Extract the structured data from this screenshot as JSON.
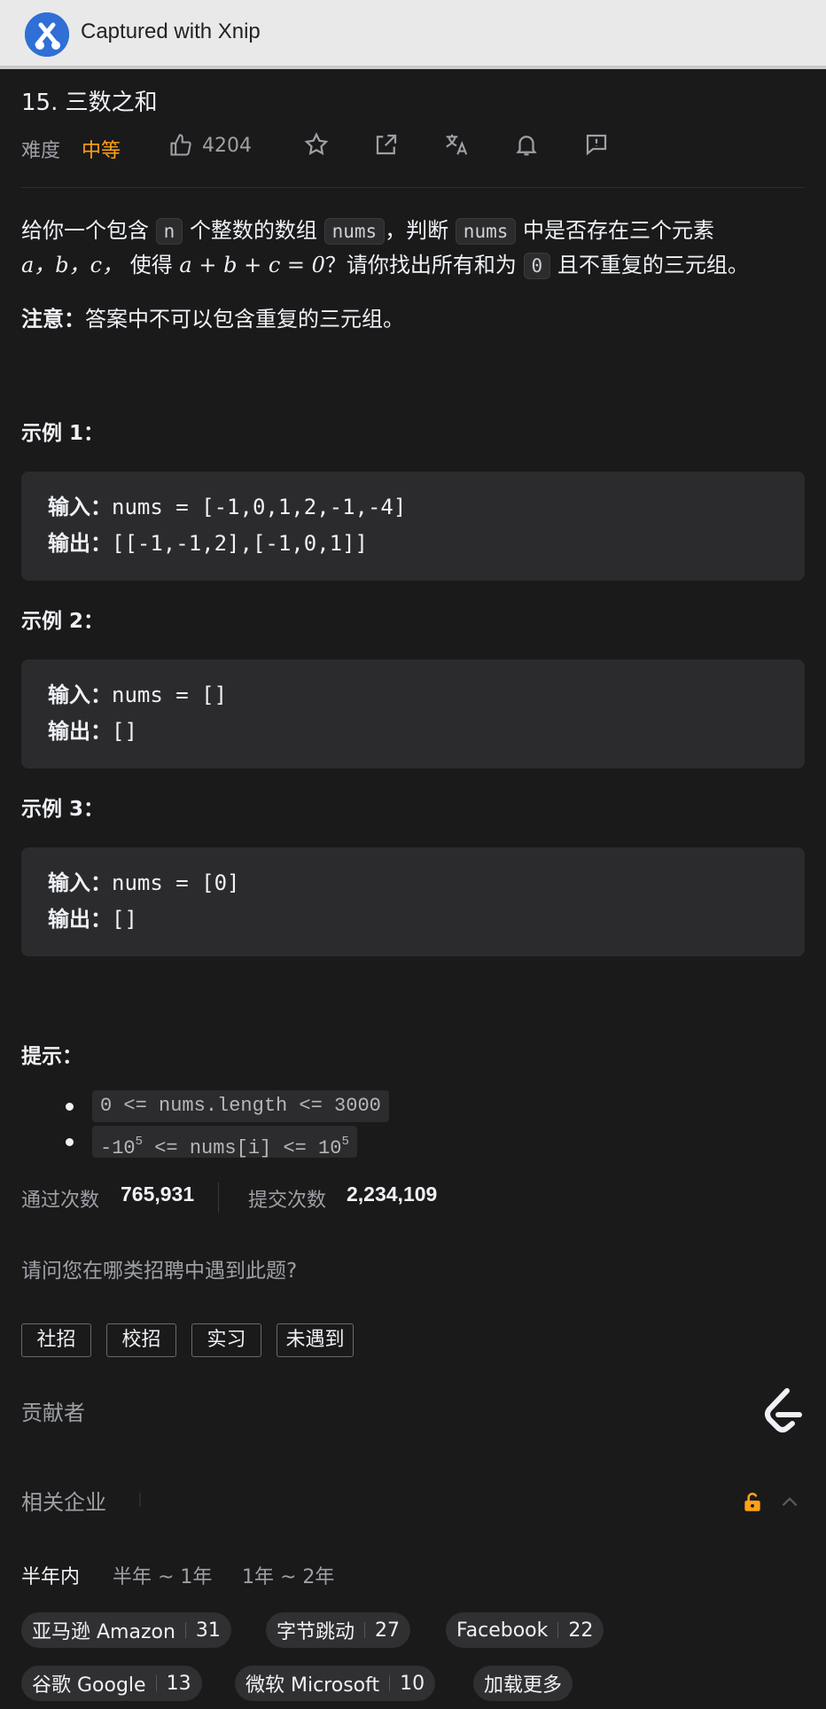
{
  "capture": {
    "title": "Captured with Xnip"
  },
  "problem": {
    "title": "15. 三数之和",
    "difficulty_label": "难度",
    "difficulty": "中等",
    "likes": "4204",
    "desc": {
      "p1": "给你一个包含",
      "n": "n",
      "p2": "个整数的数组",
      "nums1": "nums",
      "p3": "，判断",
      "nums2": "nums",
      "p4": "中是否存在三个元素",
      "abc": "a，b，c，",
      "p5": "使得",
      "eq": "a + b + c = 0",
      "p6": "？请你找出所有和为",
      "zero": "0",
      "p7": "且不重复的三元组。"
    },
    "note_label": "注意：",
    "note_text": "答案中不可以包含重复的三元组。"
  },
  "examples": [
    {
      "title": "示例 1：",
      "input_label": "输入：",
      "input": "nums = [-1,0,1,2,-1,-4]",
      "output_label": "输出：",
      "output": "[[-1,-1,2],[-1,0,1]]"
    },
    {
      "title": "示例 2：",
      "input_label": "输入：",
      "input": "nums = []",
      "output_label": "输出：",
      "output": "[]"
    },
    {
      "title": "示例 3：",
      "input_label": "输入：",
      "input": "nums = [0]",
      "output_label": "输出：",
      "output": "[]"
    }
  ],
  "hints": {
    "title": "提示：",
    "c1": "0 <= nums.length <= 3000",
    "c2_a": "-10",
    "c2_b": "5",
    "c2_c": " <= nums[i] <= 10",
    "c2_d": "5"
  },
  "stats": {
    "accepted_label": "通过次数",
    "accepted": "765,931",
    "submitted_label": "提交次数",
    "submitted": "2,234,109"
  },
  "survey": {
    "question": "请问您在哪类招聘中遇到此题?",
    "options": [
      "社招",
      "校招",
      "实习",
      "未遇到"
    ]
  },
  "contributors_label": "贡献者",
  "companies": {
    "title": "相关企业",
    "periods": [
      "半年内",
      "半年 ~ 1年",
      "1年 ~ 2年"
    ],
    "list": [
      {
        "name": "亚马逊 Amazon",
        "count": "31"
      },
      {
        "name": "字节跳动",
        "count": "27"
      },
      {
        "name": "Facebook",
        "count": "22"
      },
      {
        "name": "谷歌 Google",
        "count": "13"
      },
      {
        "name": "微软 Microsoft",
        "count": "10"
      }
    ],
    "more": "加载更多"
  },
  "colors": {
    "accent": "#ffa116",
    "background": "#1a1a1a",
    "code_bg": "#2b2b2d"
  }
}
